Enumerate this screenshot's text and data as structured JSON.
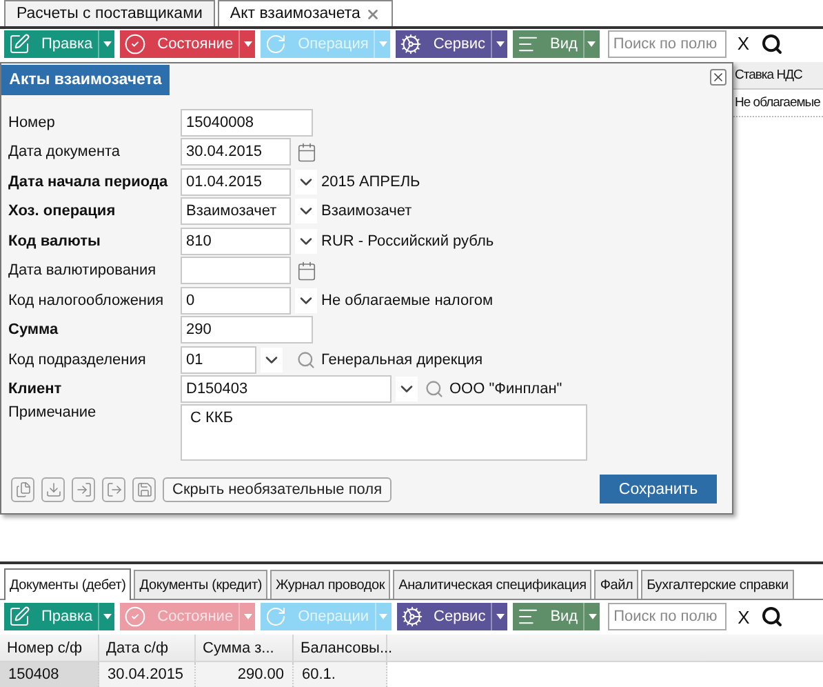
{
  "tabs": [
    {
      "label": "Расчеты с поставщиками",
      "selected": false,
      "closable": false
    },
    {
      "label": "Акт взаимозачета",
      "selected": true,
      "closable": true
    }
  ],
  "toolbar": {
    "buttons": [
      {
        "kind": "edit",
        "label": "Правка",
        "color": "#16967e",
        "disabled": false
      },
      {
        "kind": "state",
        "label": "Состояние",
        "color": "#d9404f",
        "disabled": false
      },
      {
        "kind": "operation",
        "label": "Операция",
        "color": "#8fd6f6",
        "disabled": true
      },
      {
        "kind": "service",
        "label": "Сервис",
        "color": "#5b5498",
        "disabled": false
      },
      {
        "kind": "view",
        "label": "Вид",
        "color": "#5f8f68",
        "disabled": false
      }
    ],
    "search": {
      "placeholder": "Поиск по полю"
    },
    "clear": "X"
  },
  "background_grid": {
    "columns": [
      "Ставка НДС"
    ],
    "rows": [
      [
        "Не облагаемые"
      ]
    ]
  },
  "dialog": {
    "title": "Акты взаимозачета",
    "fields": [
      {
        "kind": "text",
        "label": "Номер",
        "required": false,
        "value": "15040008"
      },
      {
        "kind": "date",
        "label": "Дата документа",
        "required": false,
        "value": "30.04.2015"
      },
      {
        "kind": "select",
        "label": "Дата начала периода",
        "required": true,
        "value": "01.04.2015",
        "description": "2015 АПРЕЛЬ"
      },
      {
        "kind": "select",
        "label": "Хоз. операция",
        "required": true,
        "value": "Взаимозачет",
        "description": "Взаимозачет"
      },
      {
        "kind": "select",
        "label": "Код валюты",
        "required": true,
        "value": "810",
        "description": "RUR - Российский рубль"
      },
      {
        "kind": "date",
        "label": "Дата валютирования",
        "required": false
      },
      {
        "kind": "select",
        "label": "Код налогообложения",
        "required": false,
        "value": "0",
        "description": "Не облагаемые налогом"
      },
      {
        "kind": "text",
        "label": "Сумма",
        "required": true,
        "value": "290"
      },
      {
        "kind": "lookup",
        "label": "Код подразделения",
        "required": false,
        "value": "01",
        "description": "Генеральная дирекция"
      },
      {
        "kind": "wide-lookup",
        "label": "Клиент",
        "required": true,
        "value": "D150403",
        "description": "ООО \"Финплан\""
      },
      {
        "kind": "memo",
        "label": "Примечание",
        "required": false,
        "value": "С ККБ"
      }
    ],
    "tool_icons": [
      {
        "kind": "copy"
      },
      {
        "kind": "import"
      },
      {
        "kind": "back"
      },
      {
        "kind": "forward"
      },
      {
        "kind": "save"
      }
    ],
    "hide_button": "Скрыть необязательные поля",
    "save_button": "Сохранить"
  },
  "detail_tabs": [
    {
      "label": "Документы (дебет)",
      "selected": true
    },
    {
      "label": "Документы (кредит)",
      "selected": false
    },
    {
      "label": "Журнал проводок",
      "selected": false
    },
    {
      "label": "Аналитическая спецификация",
      "selected": false
    },
    {
      "label": "Файл",
      "selected": false
    },
    {
      "label": "Бухгалтерские справки",
      "selected": false
    }
  ],
  "detail_toolbar": {
    "buttons": [
      {
        "kind": "edit",
        "label": "Правка",
        "color": "#16967e",
        "disabled": false
      },
      {
        "kind": "state",
        "label": "Состояние",
        "color": "#eb9ca4",
        "disabled": true
      },
      {
        "kind": "operation",
        "label": "Операции",
        "color": "#8fd6f6",
        "disabled": true
      },
      {
        "kind": "service",
        "label": "Сервис",
        "color": "#5b5498",
        "disabled": false
      },
      {
        "kind": "view",
        "label": "Вид",
        "color": "#5f8f68",
        "disabled": false
      }
    ],
    "search": {
      "placeholder": "Поиск по полю"
    },
    "clear": "X"
  },
  "table": {
    "columns": [
      "Номер с/ф",
      "Дата с/ф",
      "Сумма з...",
      "Балансовы..."
    ],
    "rows": [
      {
        "selected": true,
        "cells": [
          "150408",
          "30.04.2015",
          "290.00",
          "60.1."
        ]
      }
    ]
  }
}
